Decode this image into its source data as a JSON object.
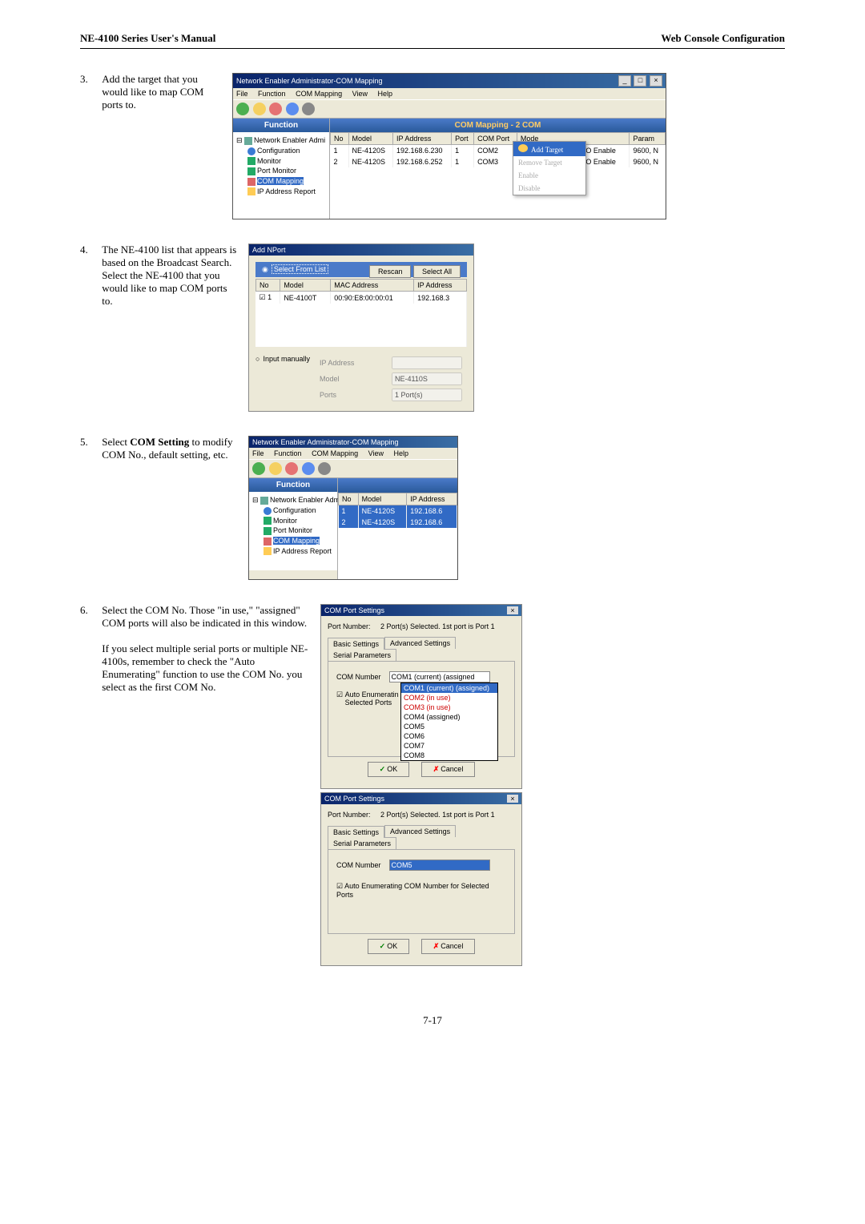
{
  "header": {
    "left": "NE-4100 Series  User's  Manual",
    "right": "Web  Console  Configuration"
  },
  "steps": {
    "s3": {
      "num": "3.",
      "text": "Add the target that you would like to map COM ports to."
    },
    "s4": {
      "num": "4.",
      "text": "The NE-4100 list that appears is based on the Broadcast Search. Select the NE-4100 that you would like to map COM ports to."
    },
    "s5": {
      "num": "5.",
      "text_prefix": "Select ",
      "bold": "COM Setting",
      "text_suffix": " to modify COM No., default setting, etc."
    },
    "s6": {
      "num": "6.",
      "p1": "Select the COM No. Those \"in use,\" \"assigned\" COM ports will also be indicated in this window.",
      "p2": "If you select multiple serial ports or multiple NE-4100s, remember to check the \"Auto Enumerating\" function to use the COM No. you select as the first COM No."
    }
  },
  "win1": {
    "title": "Network Enabler Administrator-COM Mapping",
    "menu": [
      "File",
      "Function",
      "COM Mapping",
      "View",
      "Help"
    ],
    "func_label": "Function",
    "content_label": "COM Mapping - 2 COM",
    "tree": {
      "root": "Network Enabler Admi",
      "items": [
        "Configuration",
        "Monitor",
        "Port Monitor",
        "COM Mapping",
        "IP Address Report"
      ]
    },
    "cols": [
      "No",
      "Model",
      "IP Address",
      "Port",
      "COM Port",
      "Mode",
      "Param"
    ],
    "rows": [
      [
        "1",
        "NE-4120S",
        "192.168.6.230",
        "1",
        "COM2",
        "Hi-Performance, FIFO Enable",
        "9600, N"
      ],
      [
        "2",
        "NE-4120S",
        "192.168.6.252",
        "1",
        "COM3",
        "Hi-Performance, FIFO Enable",
        "9600, N"
      ]
    ],
    "ctx": [
      "Add Target",
      "Remove Target",
      "Enable",
      "Disable"
    ]
  },
  "dlg4": {
    "title": "Add NPort",
    "radio": "Select From List",
    "btns": [
      "Rescan",
      "Select All"
    ],
    "cols": [
      "No",
      "Model",
      "MAC Address",
      "IP Address"
    ],
    "row": [
      "1",
      "NE-4100T",
      "00:90:E8:00:00:01",
      "192.168.3"
    ],
    "manual": "Input manually",
    "fields": {
      "ip": "IP Address",
      "model": "Model",
      "model_val": "NE-4110S",
      "ports": "Ports",
      "ports_val": "1 Port(s)"
    }
  },
  "win5": {
    "title": "Network Enabler Administrator-COM Mapping",
    "func_label": "Function",
    "cols": [
      "No",
      "Model",
      "IP Address"
    ],
    "rows": [
      [
        "1",
        "NE-4120S",
        "192.168.6"
      ],
      [
        "2",
        "NE-4120S",
        "192.168.6"
      ]
    ]
  },
  "dlg6a": {
    "title": "COM Port Settings",
    "port_label": "Port Number:",
    "port_val": "2 Port(s) Selected. 1st port is Port 1",
    "tabs": [
      "Basic Settings",
      "Advanced Settings",
      "Serial Parameters"
    ],
    "com_label": "COM Number",
    "com_val": "COM1 (current) (assigned",
    "dd_items": [
      "COM1 (current) (assigned)",
      "COM2 (in use)",
      "COM3 (in use)",
      "COM4 (assigned)",
      "COM5",
      "COM6",
      "COM7",
      "COM8"
    ],
    "auto_label_l1": "Auto Enumeratin",
    "auto_label_l2": "Selected Ports",
    "ok": "OK",
    "cancel": "Cancel"
  },
  "dlg6b": {
    "title": "COM Port Settings",
    "port_label": "Port Number:",
    "port_val": "2 Port(s) Selected. 1st port is Port 1",
    "tabs": [
      "Basic Settings",
      "Advanced Settings",
      "Serial Parameters"
    ],
    "com_label": "COM Number",
    "com_val": "COM5",
    "auto_label": "Auto Enumerating COM Number for Selected Ports",
    "ok": "OK",
    "cancel": "Cancel"
  },
  "footer": "7-17"
}
